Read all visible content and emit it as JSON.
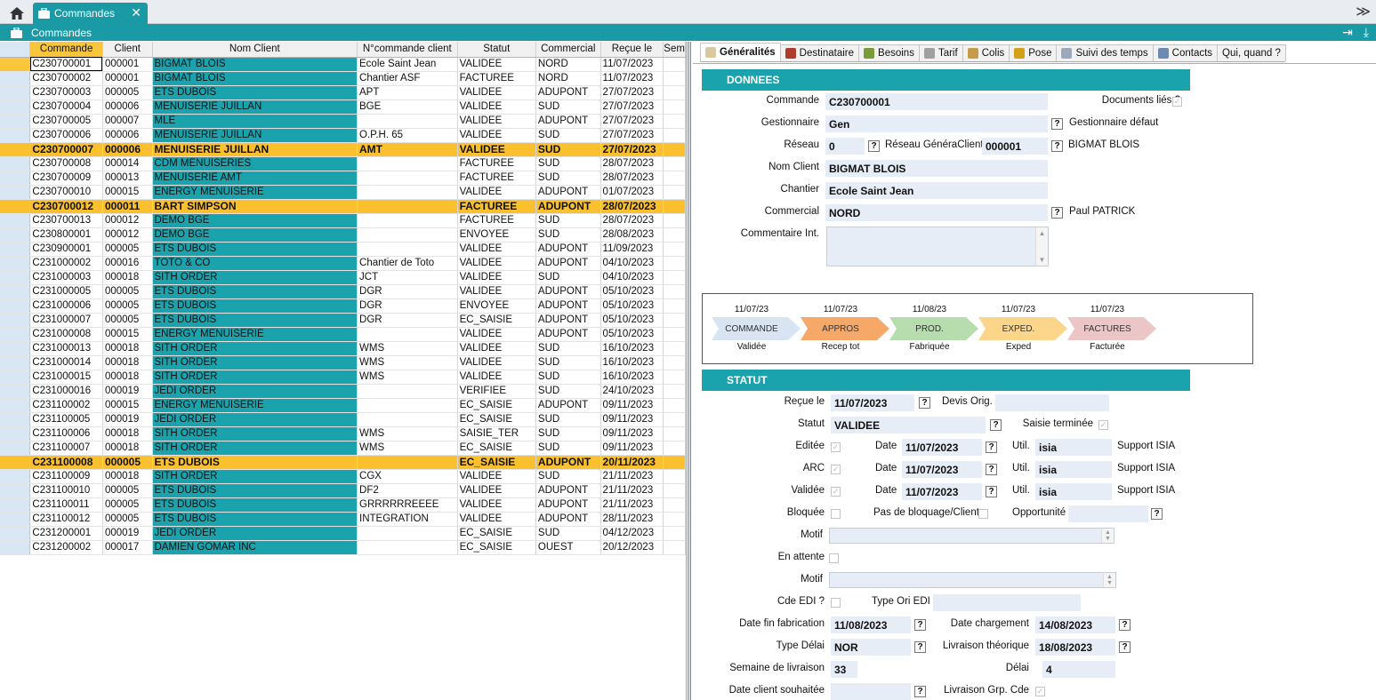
{
  "app": {
    "tab_title": "Commandes",
    "window_title": "Commandes",
    "tab_close": "✕",
    "collapse_icon": "≫"
  },
  "grid": {
    "columns": [
      "Commande",
      "Client",
      "Nom Client",
      "N°commande client",
      "Statut",
      "Commercial",
      "Reçue le",
      "Sem"
    ],
    "rows": [
      [
        "C230700001",
        "000001",
        "BIGMAT BLOIS",
        "Ecole Saint Jean",
        "VALIDEE",
        "NORD",
        "11/07/2023"
      ],
      [
        "C230700002",
        "000001",
        "BIGMAT BLOIS",
        "Chantier ASF",
        "FACTUREE",
        "NORD",
        "11/07/2023"
      ],
      [
        "C230700003",
        "000005",
        "ETS DUBOIS",
        "APT",
        "VALIDEE",
        "ADUPONT",
        "27/07/2023"
      ],
      [
        "C230700004",
        "000006",
        "MENUISERIE JUILLAN",
        "BGE",
        "VALIDEE",
        "SUD",
        "27/07/2023"
      ],
      [
        "C230700005",
        "000007",
        "MLE",
        "",
        "VALIDEE",
        "ADUPONT",
        "27/07/2023"
      ],
      [
        "C230700006",
        "000006",
        "MENUISERIE JUILLAN",
        "O.P.H. 65",
        "VALIDEE",
        "SUD",
        "27/07/2023"
      ],
      [
        "C230700007",
        "000006",
        "MENUISERIE JUILLAN",
        "AMT",
        "VALIDEE",
        "SUD",
        "27/07/2023"
      ],
      [
        "C230700008",
        "000014",
        "CDM MENUISERIES",
        "",
        "FACTUREE",
        "SUD",
        "28/07/2023"
      ],
      [
        "C230700009",
        "000013",
        "MENUISERIE AMT",
        "",
        "FACTUREE",
        "SUD",
        "28/07/2023"
      ],
      [
        "C230700010",
        "000015",
        "ENERGY MENUISERIE",
        "",
        "VALIDEE",
        "ADUPONT",
        "01/07/2023"
      ],
      [
        "C230700012",
        "000011",
        "BART SIMPSON",
        "",
        "FACTUREE",
        "ADUPONT",
        "28/07/2023"
      ],
      [
        "C230700013",
        "000012",
        "DEMO BGE",
        "",
        "FACTUREE",
        "SUD",
        "28/07/2023"
      ],
      [
        "C230800001",
        "000012",
        "DEMO BGE",
        "",
        "ENVOYEE",
        "SUD",
        "28/08/2023"
      ],
      [
        "C230900001",
        "000005",
        "ETS DUBOIS",
        "",
        "VALIDEE",
        "ADUPONT",
        "11/09/2023"
      ],
      [
        "C231000002",
        "000016",
        "TOTO & CO",
        "Chantier de Toto",
        "VALIDEE",
        "ADUPONT",
        "04/10/2023"
      ],
      [
        "C231000003",
        "000018",
        "SITH ORDER",
        "JCT",
        "VALIDEE",
        "SUD",
        "04/10/2023"
      ],
      [
        "C231000005",
        "000005",
        "ETS DUBOIS",
        "DGR",
        "VALIDEE",
        "ADUPONT",
        "05/10/2023"
      ],
      [
        "C231000006",
        "000005",
        "ETS DUBOIS",
        "DGR",
        "ENVOYEE",
        "ADUPONT",
        "05/10/2023"
      ],
      [
        "C231000007",
        "000005",
        "ETS DUBOIS",
        "DGR",
        "EC_SAISIE",
        "ADUPONT",
        "05/10/2023"
      ],
      [
        "C231000008",
        "000015",
        "ENERGY MENUISERIE",
        "",
        "VALIDEE",
        "ADUPONT",
        "05/10/2023"
      ],
      [
        "C231000013",
        "000018",
        "SITH ORDER",
        "WMS",
        "VALIDEE",
        "SUD",
        "16/10/2023"
      ],
      [
        "C231000014",
        "000018",
        "SITH ORDER",
        "WMS",
        "VALIDEE",
        "SUD",
        "16/10/2023"
      ],
      [
        "C231000015",
        "000018",
        "SITH ORDER",
        "WMS",
        "VALIDEE",
        "SUD",
        "16/10/2023"
      ],
      [
        "C231000016",
        "000019",
        "JEDI ORDER",
        "",
        "VERIFIEE",
        "SUD",
        "24/10/2023"
      ],
      [
        "C231100002",
        "000015",
        "ENERGY MENUISERIE",
        "",
        "EC_SAISIE",
        "ADUPONT",
        "09/11/2023"
      ],
      [
        "C231100005",
        "000019",
        "JEDI ORDER",
        "",
        "EC_SAISIE",
        "SUD",
        "09/11/2023"
      ],
      [
        "C231100006",
        "000018",
        "SITH ORDER",
        "WMS",
        "SAISIE_TER",
        "SUD",
        "09/11/2023"
      ],
      [
        "C231100007",
        "000018",
        "SITH ORDER",
        "WMS",
        "EC_SAISIE",
        "SUD",
        "09/11/2023"
      ],
      [
        "C231100008",
        "000005",
        "ETS DUBOIS",
        "",
        "EC_SAISIE",
        "ADUPONT",
        "20/11/2023"
      ],
      [
        "C231100009",
        "000018",
        "SITH ORDER",
        "CGX",
        "VALIDEE",
        "SUD",
        "21/11/2023"
      ],
      [
        "C231100010",
        "000005",
        "ETS DUBOIS",
        "DF2",
        "VALIDEE",
        "ADUPONT",
        "21/11/2023"
      ],
      [
        "C231100011",
        "000005",
        "ETS DUBOIS",
        "GRRRRRREEEE",
        "VALIDEE",
        "ADUPONT",
        "21/11/2023"
      ],
      [
        "C231100012",
        "000005",
        "ETS DUBOIS",
        "INTEGRATION",
        "VALIDEE",
        "ADUPONT",
        "28/11/2023"
      ],
      [
        "C231200001",
        "000019",
        "JEDI ORDER",
        "",
        "EC_SAISIE",
        "SUD",
        "04/12/2023"
      ],
      [
        "C231200002",
        "000017",
        "DAMIEN GOMAR INC",
        "",
        "EC_SAISIE",
        "OUEST",
        "20/12/2023"
      ]
    ],
    "highlighted_rows": [
      6,
      10,
      28
    ],
    "selected_row": 0
  },
  "tabs": [
    "Généralités",
    "Destinataire",
    "Besoins",
    "Tarif",
    "Colis",
    "Pose",
    "Suivi des temps",
    "Contacts",
    "Qui, quand ?"
  ],
  "donnees": {
    "section_title": "DONNEES",
    "commande_label": "Commande",
    "commande": "C230700001",
    "docs_lies_label": "Documents liés ?",
    "gestionnaire_label": "Gestionnaire",
    "gestionnaire": "Gen",
    "gestionnaire_defaut": "Gestionnaire défaut",
    "reseau_label": "Réseau",
    "reseau": "0",
    "reseau_client_label": "Réseau GénéraClient",
    "reseau_client": "000001",
    "reseau_client_name": "BIGMAT BLOIS",
    "nom_client_label": "Nom Client",
    "nom_client": "BIGMAT BLOIS",
    "chantier_label": "Chantier",
    "chantier": "Ecole Saint Jean",
    "commercial_label": "Commercial",
    "commercial": "NORD",
    "commercial_name": "Paul PATRICK",
    "commentaire_label": "Commentaire Int."
  },
  "workflow": [
    {
      "date": "11/07/23",
      "label": "COMMANDE",
      "sub": "Validée",
      "color": "#d9e4f3"
    },
    {
      "date": "11/07/23",
      "label": "APPROS",
      "sub": "Recep tot",
      "color": "#f6a868"
    },
    {
      "date": "11/08/23",
      "label": "PROD.",
      "sub": "Fabriquée",
      "color": "#b7dcae"
    },
    {
      "date": "11/07/23",
      "label": "EXPED.",
      "sub": "Exped",
      "color": "#fbd68a"
    },
    {
      "date": "11/07/23",
      "label": "FACTURES",
      "sub": "Facturée",
      "color": "#ecc6c6"
    }
  ],
  "statut": {
    "section_title": "STATUT",
    "recue_label": "Reçue le",
    "recue": "11/07/2023",
    "devis_label": "Devis Orig.",
    "statut_label": "Statut",
    "statut": "VALIDEE",
    "saisie_label": "Saisie terminée",
    "editee_label": "Editée",
    "arc_label": "ARC",
    "validee_label": "Validée",
    "date_label": "Date",
    "util_label": "Util.",
    "editee_date": "11/07/2023",
    "arc_date": "11/07/2023",
    "validee_date": "11/07/2023",
    "util": "isia",
    "support": "Support ISIA",
    "bloquee_label": "Bloquée",
    "pas_blocage_label": "Pas de bloquage/Client",
    "opportunite_label": "Opportunité",
    "motif_label": "Motif",
    "en_attente_label": "En attente",
    "cde_edi_label": "Cde EDI ?",
    "type_ori_label": "Type Ori EDI",
    "date_fin_fab_label": "Date fin fabrication",
    "date_fin_fab": "11/08/2023",
    "date_chargement_label": "Date chargement",
    "date_chargement": "14/08/2023",
    "type_delai_label": "Type Délai",
    "type_delai": "NOR",
    "livraison_theo_label": "Livraison théorique",
    "livraison_theo": "18/08/2023",
    "semaine_label": "Semaine de livraison",
    "semaine": "33",
    "delai_label": "Délai",
    "delai": "4",
    "date_client_label": "Date client souhaitée",
    "livraison_grp_label": "Livraison Grp. Cde"
  },
  "colors": {
    "accent": "#1aa3ad",
    "highlight": "#fbc02d"
  }
}
